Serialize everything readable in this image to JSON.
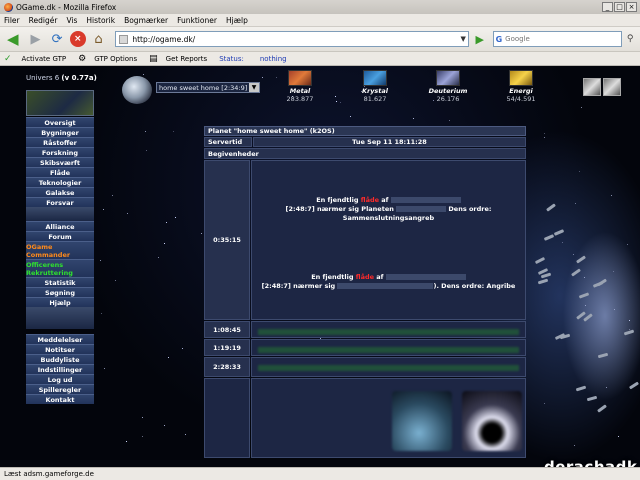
{
  "browser": {
    "title": "OGame.dk - Mozilla Firefox",
    "menu": [
      "Filer",
      "Redigér",
      "Vis",
      "Historik",
      "Bogmærker",
      "Funktioner",
      "Hjælp"
    ],
    "url": "http://ogame.dk/",
    "search_placeholder": "Google",
    "search_engine_icon": "G",
    "toolbar": {
      "activate_gtp": "Activate GTP",
      "gtp_options": "GTP Options",
      "get_reports": "Get Reports",
      "status_label": "Status:",
      "status_value": "nothing"
    },
    "statusbar": "Læst adsm.gameforge.de"
  },
  "game": {
    "universe": "Univers 6",
    "version": "(v 0.77a)",
    "planet_select": "home sweet home [2:34:9]",
    "resources": [
      {
        "name": "Metal",
        "value": "283.877",
        "icon": "metal-icon"
      },
      {
        "name": "Krystal",
        "value": "81.627",
        "icon": "crystal-icon"
      },
      {
        "name": "Deuterium",
        "value": "26.176",
        "icon": "deuterium-icon"
      },
      {
        "name": "Energi",
        "value": "54/4.591",
        "icon": "energy-icon"
      }
    ],
    "menu_main": [
      "Oversigt",
      "Bygninger",
      "Råstoffer",
      "Forskning",
      "Skibsværft",
      "Flåde",
      "Teknologier",
      "Galakse",
      "Forsvar"
    ],
    "menu_mid": [
      "Alliance",
      "Forum"
    ],
    "commander": "OGame Commander",
    "officers": "Officerens Rekruttering",
    "menu_mid2": [
      "Statistik",
      "Søgning",
      "Hjælp"
    ],
    "menu_bottom": [
      "Meddelelser",
      "Notitser",
      "Buddyliste",
      "Indstillinger",
      "Log ud",
      "Spilleregler",
      "Kontakt"
    ],
    "overview": {
      "title": "Planet \"home sweet home\" (k2OS)",
      "server_label": "Servertid",
      "server_time": "Tue Sep 11 18:11:28",
      "events_label": "Begivenheder",
      "event1_time": "0:35:15",
      "event1_a_pre": "En fjendtlig",
      "event1_a_post": "af",
      "event1_b": "[2:48:7] nærmer sig Planeten",
      "event1_c": "Dens ordre:",
      "event1_d": "Sammenslutningsangreb",
      "event2_pre": "En fjendtlig",
      "event2_post": "af",
      "event2_b": "[2:48:7] nærmer sig",
      "event2_c": "). Dens ordre: Angribe",
      "times": [
        "1:08:45",
        "1:19:19",
        "2:28:33"
      ]
    },
    "watermark": "derachadk"
  }
}
